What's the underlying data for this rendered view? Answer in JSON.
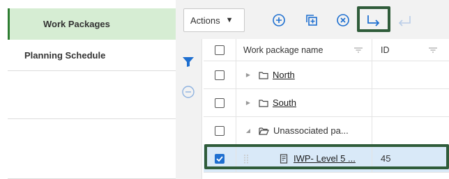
{
  "sidebar": {
    "items": [
      {
        "label": "Work Packages",
        "active": true
      },
      {
        "label": "Planning Schedule",
        "active": false
      }
    ]
  },
  "toolbar": {
    "actions_label": "Actions",
    "icons": [
      "add-circle-icon",
      "add-copy-icon",
      "remove-circle-icon",
      "indent-icon",
      "outdent-icon"
    ]
  },
  "filter": {
    "icons": [
      "filter-icon",
      "collapse-minus-icon"
    ]
  },
  "grid": {
    "columns": [
      {
        "label": "Work package name"
      },
      {
        "label": "ID"
      }
    ],
    "rows": [
      {
        "name": "North",
        "id": "",
        "icon": "folder-icon",
        "expander": "collapsed",
        "checked": false,
        "link": true
      },
      {
        "name": "South",
        "id": "",
        "icon": "folder-icon",
        "expander": "collapsed",
        "checked": false,
        "link": true
      },
      {
        "name": "Unassociated pa...",
        "id": "",
        "icon": "folder-open-icon",
        "expander": "expanded",
        "checked": false,
        "link": false
      },
      {
        "name": "IWP- Level 5 ...",
        "id": "45",
        "icon": "document-icon",
        "expander": "drag",
        "checked": true,
        "link": true
      }
    ]
  },
  "colors": {
    "active_bg": "#d6edd3",
    "active_bar": "#2e7d32",
    "accent_blue": "#1e6fd0",
    "highlight_frame": "#2f5c3a",
    "selected_row": "#d9e9f8"
  }
}
